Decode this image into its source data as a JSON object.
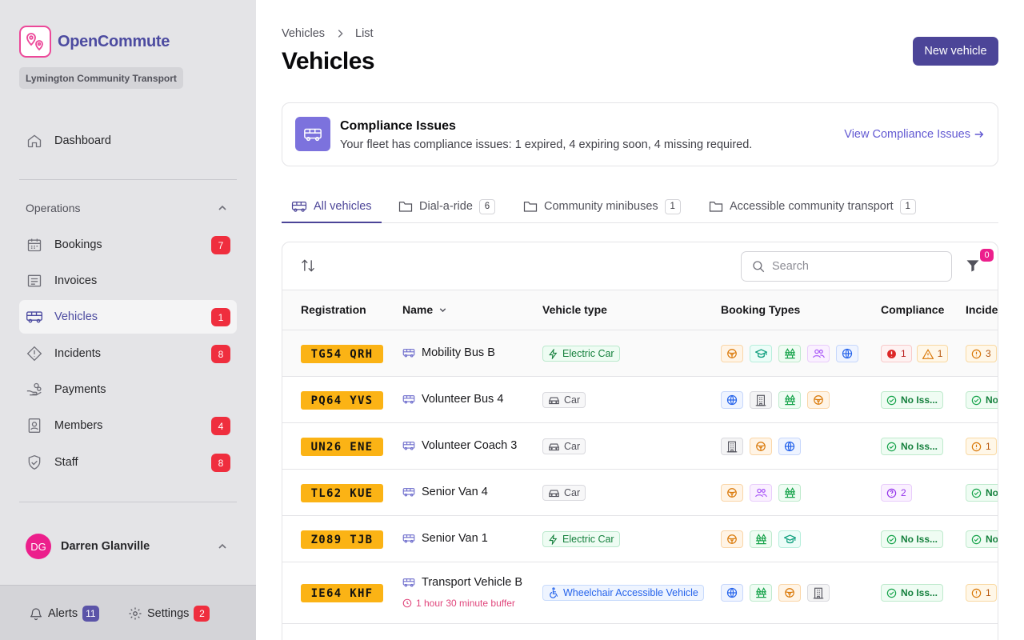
{
  "app": {
    "name": "OpenCommute",
    "org": "Lymington Community Transport"
  },
  "sidebar": {
    "dashboard": "Dashboard",
    "section": "Operations",
    "items": [
      {
        "label": "Bookings",
        "badge": "7"
      },
      {
        "label": "Invoices",
        "badge": ""
      },
      {
        "label": "Vehicles",
        "badge": "1"
      },
      {
        "label": "Incidents",
        "badge": "8"
      },
      {
        "label": "Payments",
        "badge": ""
      },
      {
        "label": "Members",
        "badge": "4"
      },
      {
        "label": "Staff",
        "badge": "8"
      }
    ],
    "user": {
      "initials": "DG",
      "name": "Darren Glanville"
    },
    "footer": {
      "alerts_label": "Alerts",
      "alerts_count": "11",
      "settings_label": "Settings",
      "settings_count": "2"
    }
  },
  "header": {
    "breadcrumb": [
      "Vehicles",
      "List"
    ],
    "title": "Vehicles",
    "new_button": "New vehicle"
  },
  "compliance_alert": {
    "title": "Compliance Issues",
    "message": "Your fleet has compliance issues: 1 expired, 4 expiring soon, 4 missing required.",
    "link": "View Compliance Issues"
  },
  "tabs": [
    {
      "label": "All vehicles",
      "count": ""
    },
    {
      "label": "Dial-a-ride",
      "count": "6"
    },
    {
      "label": "Community minibuses",
      "count": "1"
    },
    {
      "label": "Accessible community transport",
      "count": "1"
    }
  ],
  "search": {
    "placeholder": "Search"
  },
  "filter_count": "0",
  "table": {
    "columns": [
      "Registration",
      "Name",
      "Vehicle type",
      "Booking Types",
      "Compliance",
      "Incide"
    ],
    "rows": [
      {
        "reg": "TG54 QRH",
        "name": "Mobility Bus B",
        "type": "Electric Car",
        "booking_types": [
          "steering-wheel-icon",
          "graduation-cap-icon",
          "trees-icon",
          "users-icon",
          "globe-icon"
        ],
        "compliance": [
          {
            "kind": "expired",
            "value": "1"
          },
          {
            "kind": "expiring",
            "value": "1"
          }
        ],
        "incidents": "3"
      },
      {
        "reg": "PQ64 YVS",
        "name": "Volunteer Bus 4",
        "type": "Car",
        "booking_types": [
          "globe-icon",
          "building-icon",
          "trees-icon",
          "steering-wheel-icon"
        ],
        "compliance": [
          {
            "kind": "ok",
            "value": "No Iss..."
          }
        ],
        "incidents": "No"
      },
      {
        "reg": "UN26 ENE",
        "name": "Volunteer Coach 3",
        "type": "Car",
        "booking_types": [
          "building-icon",
          "steering-wheel-icon",
          "globe-icon"
        ],
        "compliance": [
          {
            "kind": "ok",
            "value": "No Iss..."
          }
        ],
        "incidents": "1"
      },
      {
        "reg": "TL62 KUE",
        "name": "Senior Van 4",
        "type": "Car",
        "booking_types": [
          "steering-wheel-icon",
          "users-icon",
          "trees-icon"
        ],
        "compliance": [
          {
            "kind": "missing",
            "value": "2"
          }
        ],
        "incidents": "No"
      },
      {
        "reg": "Z089 TJB",
        "name": "Senior Van 1",
        "type": "Electric Car",
        "booking_types": [
          "steering-wheel-icon",
          "trees-icon",
          "graduation-cap-icon"
        ],
        "compliance": [
          {
            "kind": "ok",
            "value": "No Iss..."
          }
        ],
        "incidents": "No"
      },
      {
        "reg": "IE64 KHF",
        "name": "Transport Vehicle B",
        "buffer": "1 hour 30 minute buffer",
        "type": "Wheelchair Accessible Vehicle",
        "booking_types": [
          "globe-icon",
          "trees-icon",
          "steering-wheel-icon",
          "building-icon"
        ],
        "compliance": [
          {
            "kind": "ok",
            "value": "No Iss..."
          }
        ],
        "incidents": "1"
      }
    ]
  },
  "colors": {
    "brand": "#4c4598",
    "accent": "#ec1f8c",
    "plate": "#fbb315",
    "badge_red": "#ef2e3e"
  }
}
